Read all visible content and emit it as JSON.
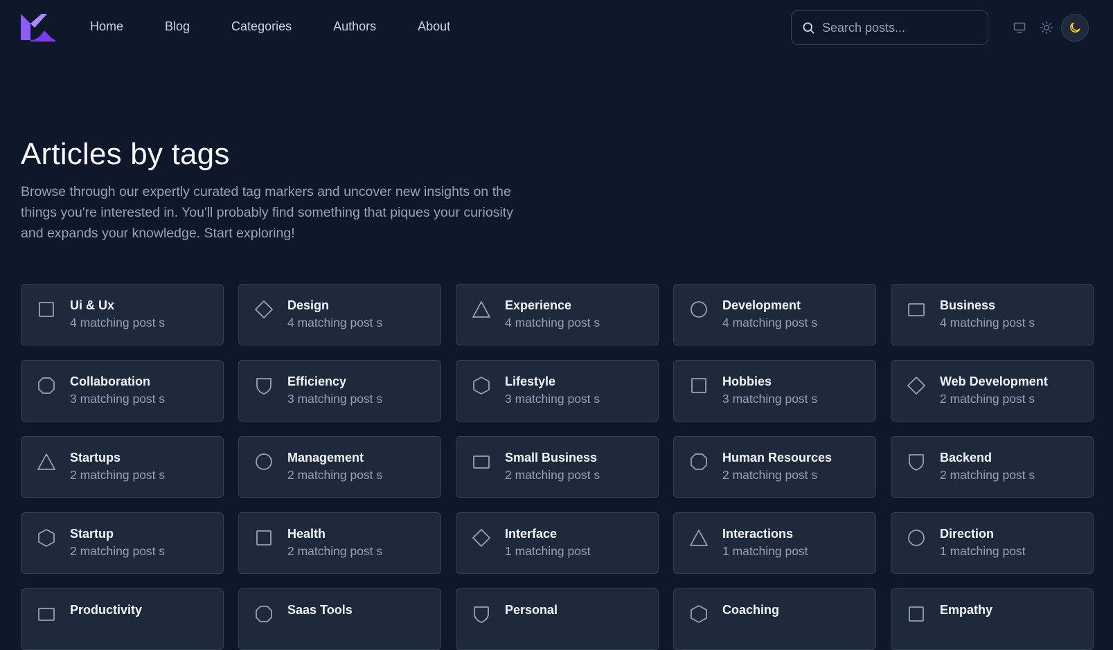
{
  "nav": {
    "links": [
      "Home",
      "Blog",
      "Categories",
      "Authors",
      "About"
    ]
  },
  "search": {
    "placeholder": "Search posts..."
  },
  "theme": {
    "active": "dark",
    "accent": "#facc15"
  },
  "brand": {
    "logo_color": "#8b5cf6"
  },
  "hero": {
    "title": "Articles by tags",
    "description": "Browse through our expertly curated tag markers and uncover new insights on the things you're interested in. You'll probably find something that piques your curiosity and expands your knowledge. Start exploring!"
  },
  "tags": [
    {
      "name": "Ui & Ux",
      "count": "4 matching post s",
      "icon": "square"
    },
    {
      "name": "Design",
      "count": "4 matching post s",
      "icon": "diamond"
    },
    {
      "name": "Experience",
      "count": "4 matching post s",
      "icon": "triangle"
    },
    {
      "name": "Development",
      "count": "4 matching post s",
      "icon": "circle"
    },
    {
      "name": "Business",
      "count": "4 matching post s",
      "icon": "rectangle"
    },
    {
      "name": "Collaboration",
      "count": "3 matching post s",
      "icon": "octagon"
    },
    {
      "name": "Efficiency",
      "count": "3 matching post s",
      "icon": "shield"
    },
    {
      "name": "Lifestyle",
      "count": "3 matching post s",
      "icon": "hexagon"
    },
    {
      "name": "Hobbies",
      "count": "3 matching post s",
      "icon": "square"
    },
    {
      "name": "Web Development",
      "count": "2 matching post s",
      "icon": "diamond"
    },
    {
      "name": "Startups",
      "count": "2 matching post s",
      "icon": "triangle"
    },
    {
      "name": "Management",
      "count": "2 matching post s",
      "icon": "circle"
    },
    {
      "name": "Small Business",
      "count": "2 matching post s",
      "icon": "rectangle"
    },
    {
      "name": "Human Resources",
      "count": "2 matching post s",
      "icon": "octagon"
    },
    {
      "name": "Backend",
      "count": "2 matching post s",
      "icon": "shield"
    },
    {
      "name": "Startup",
      "count": "2 matching post s",
      "icon": "hexagon"
    },
    {
      "name": "Health",
      "count": "2 matching post s",
      "icon": "square"
    },
    {
      "name": "Interface",
      "count": "1 matching post",
      "icon": "diamond"
    },
    {
      "name": "Interactions",
      "count": "1 matching post",
      "icon": "triangle"
    },
    {
      "name": "Direction",
      "count": "1 matching post",
      "icon": "circle"
    },
    {
      "name": "Productivity",
      "count": "",
      "icon": "rectangle"
    },
    {
      "name": "Saas Tools",
      "count": "",
      "icon": "octagon"
    },
    {
      "name": "Personal",
      "count": "",
      "icon": "shield"
    },
    {
      "name": "Coaching",
      "count": "",
      "icon": "hexagon"
    },
    {
      "name": "Empathy",
      "count": "",
      "icon": "square"
    }
  ]
}
